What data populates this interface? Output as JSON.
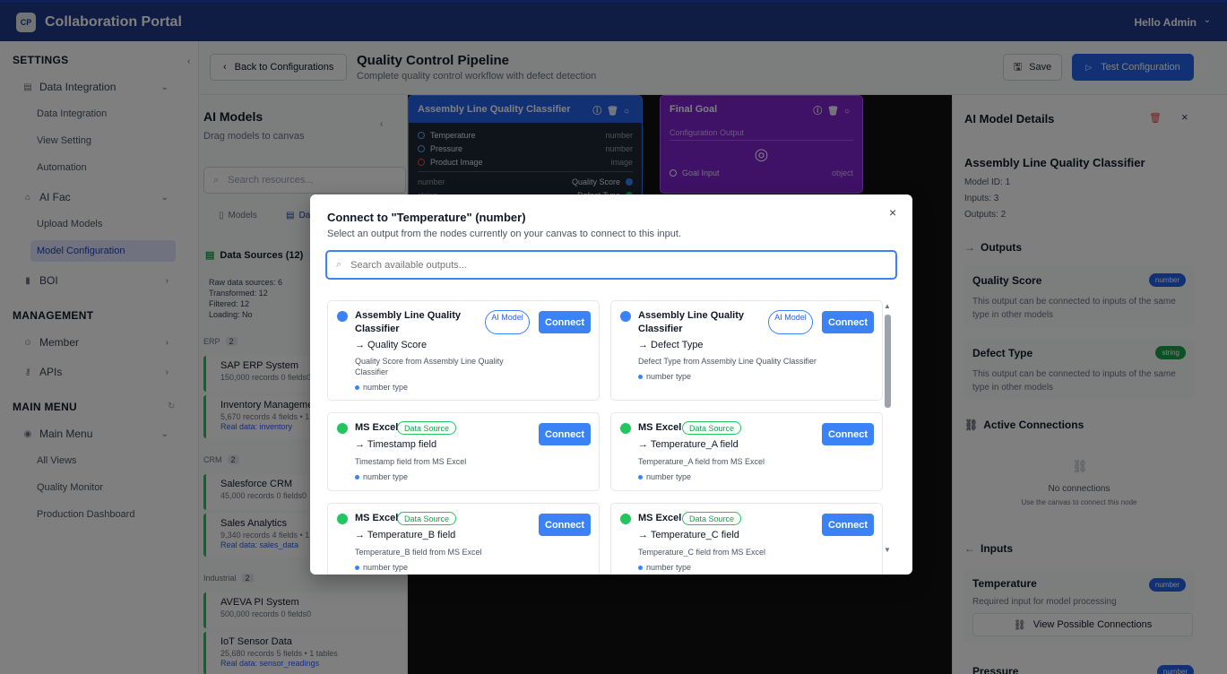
{
  "app": {
    "logo": "CP",
    "title": "Collaboration Portal",
    "greeting": "Hello Admin"
  },
  "sidebar": {
    "settings_label": "SETTINGS",
    "management_label": "MANAGEMENT",
    "main_menu_label": "MAIN MENU",
    "items": {
      "data_integration": "Data Integration",
      "data_integration_sub": "Data Integration",
      "view_setting": "View Setting",
      "automation": "Automation",
      "ai_fac": "AI Fac",
      "upload_models": "Upload Models",
      "model_configuration": "Model Configuration",
      "boi": "BOI",
      "member": "Member",
      "apis": "APIs",
      "main_menu": "Main Menu",
      "all_views": "All Views",
      "quality_monitor": "Quality Monitor",
      "production_dashboard": "Production Dashboard"
    }
  },
  "header": {
    "back_label": "Back to Configurations",
    "title": "Quality Control Pipeline",
    "subtitle": "Complete quality control workflow with defect detection",
    "save_label": "Save",
    "test_label": "Test Configuration"
  },
  "models_panel": {
    "title": "AI Models",
    "subtitle": "Drag models to canvas",
    "search_placeholder": "Search resources...",
    "tab_models": "Models",
    "tab_data": "Dat",
    "data_sources_title": "Data Sources (12)",
    "stats": [
      "Raw data sources: 6",
      "Transformed: 12",
      "Filtered: 12",
      "Loading: No"
    ],
    "categories": [
      {
        "name": "ERP",
        "count": "2"
      },
      {
        "name": "CRM",
        "count": "2"
      },
      {
        "name": "Industrial",
        "count": "2"
      }
    ],
    "sources": [
      {
        "name": "SAP ERP System",
        "meta": "150,000 records 0 fields0",
        "real": ""
      },
      {
        "name": "Inventory Manageme",
        "meta": "5,670 records 4 fields • 1",
        "real": "Real data: inventory"
      },
      {
        "name": "Salesforce CRM",
        "meta": "45,000 records 0 fields0",
        "real": ""
      },
      {
        "name": "Sales Analytics",
        "meta": "9,340 records 4 fields • 1",
        "real": "Real data: sales_data"
      },
      {
        "name": "AVEVA PI System",
        "meta": "500,000 records 0 fields0",
        "real": ""
      },
      {
        "name": "IoT Sensor Data",
        "meta": "25,680 records 5 fields • 1 tables",
        "real": "Real data: sensor_readings"
      }
    ]
  },
  "canvas": {
    "classifier_node": {
      "title": "Assembly Line Quality Classifier",
      "inputs": [
        {
          "name": "Temperature",
          "type": "number"
        },
        {
          "name": "Pressure",
          "type": "number"
        },
        {
          "name": "Product Image",
          "type": "image"
        }
      ],
      "outputs": [
        {
          "left": "number",
          "name": "Quality Score"
        },
        {
          "left": "string",
          "name": "Defect Type"
        }
      ]
    },
    "goal_node": {
      "title": "Final Goal",
      "config_output": "Configuration Output",
      "input_name": "Goal Input",
      "input_type": "object"
    }
  },
  "details": {
    "title": "AI Model Details",
    "model_name": "Assembly Line Quality Classifier",
    "model_id": "Model ID: 1",
    "inputs_count": "Inputs: 3",
    "outputs_count": "Outputs: 2",
    "outputs_label": "Outputs",
    "outputs": [
      {
        "name": "Quality Score",
        "type": "number",
        "desc": "This output can be connected to inputs of the same type in other models"
      },
      {
        "name": "Defect Type",
        "type": "string",
        "desc": "This output can be connected to inputs of the same type in other models"
      }
    ],
    "active_connections_label": "Active Connections",
    "no_connections": "No connections",
    "no_connections_hint": "Use the canvas to connect this node",
    "inputs_label": "Inputs",
    "input_card": {
      "name": "Temperature",
      "type": "number",
      "desc": "Required input for model processing",
      "button": "View Possible Connections"
    },
    "next_input": {
      "name": "Pressure",
      "type": "number"
    }
  },
  "modal": {
    "title": "Connect to \"Temperature\" (number)",
    "subtitle": "Select an output from the nodes currently on your canvas to connect to this input.",
    "search_placeholder": "Search available outputs...",
    "connect_label": "Connect",
    "cards": [
      {
        "source": "Assembly Line Quality Classifier",
        "badge": "AI Model",
        "field": "→ Quality Score",
        "desc": "Quality Score from Assembly Line Quality Classifier",
        "type": "number type",
        "color": "#3b82f6"
      },
      {
        "source": "Assembly Line Quality Classifier",
        "badge": "AI Model",
        "field": "→ Defect Type",
        "desc": "Defect Type from Assembly Line Quality Classifier",
        "type": "number type",
        "color": "#3b82f6"
      },
      {
        "source": "MS Excel",
        "badge": "Data Source",
        "field": "→ Timestamp field",
        "desc": "Timestamp field from MS Excel",
        "type": "number type",
        "color": "#22c55e"
      },
      {
        "source": "MS Excel",
        "badge": "Data Source",
        "field": "→ Temperature_A field",
        "desc": "Temperature_A field from MS Excel",
        "type": "number type",
        "color": "#22c55e"
      },
      {
        "source": "MS Excel",
        "badge": "Data Source",
        "field": "→ Temperature_B field",
        "desc": "Temperature_B field from MS Excel",
        "type": "number type",
        "color": "#22c55e"
      },
      {
        "source": "MS Excel",
        "badge": "Data Source",
        "field": "→ Temperature_C field",
        "desc": "Temperature_C field from MS Excel",
        "type": "number type",
        "color": "#22c55e"
      }
    ]
  },
  "colors": {
    "header": "#1e3a8a",
    "primary": "#2563eb",
    "classifier_node": "#2563eb",
    "goal_node": "#7e22ce",
    "data_source": "#22c55e"
  }
}
